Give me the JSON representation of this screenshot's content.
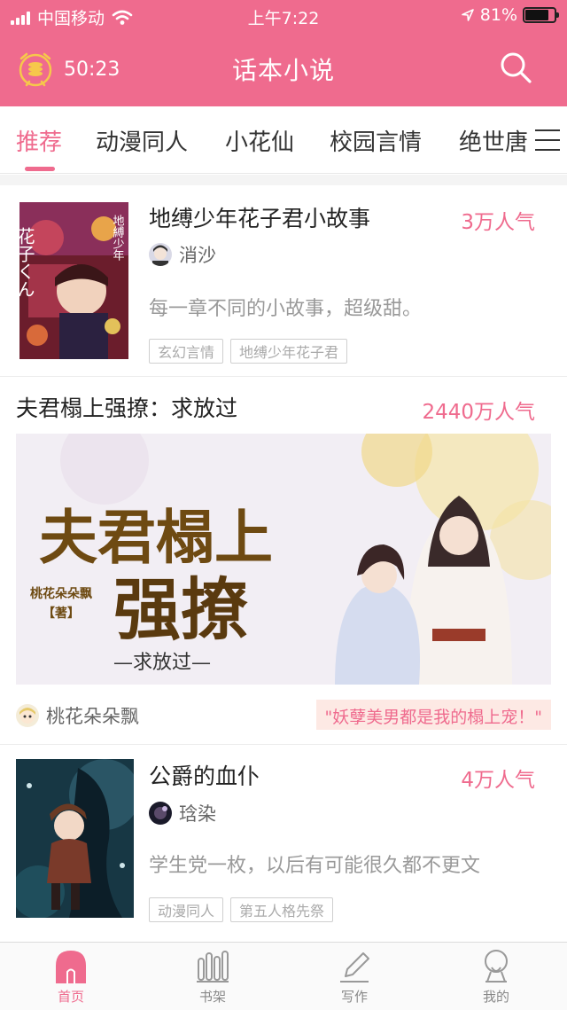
{
  "status_bar": {
    "carrier": "中国移动",
    "time": "上午7:22",
    "battery": "81%",
    "battery_level": 0.81
  },
  "header": {
    "timer": "50:23",
    "title": "话本小说"
  },
  "tabs": [
    "推荐",
    "动漫同人",
    "小花仙",
    "校园言情",
    "绝世唐"
  ],
  "cards": [
    {
      "title": "地缚少年花子君小故事",
      "popularity": "3万人气",
      "author": "消沙",
      "description": "每一章不同的小故事，超级甜。",
      "tags": [
        "玄幻言情",
        "地缚少年花子君"
      ]
    },
    {
      "title": "夫君榻上强撩：求放过",
      "popularity": "2440万人气",
      "author": "桃花朵朵飘",
      "quote": "\"妖孽美男都是我的榻上宠！\"",
      "banner_text": {
        "line1": "夫君榻上",
        "line2": "强撩",
        "subtitle": "—求放过—",
        "author_tag": "桃花朵朵飘",
        "author_suffix": "【著】"
      }
    },
    {
      "title": "公爵的血仆",
      "popularity": "4万人气",
      "author": "琀染",
      "description": "学生党一枚，以后有可能很久都不更文",
      "tags": [
        "动漫同人",
        "第五人格先祭"
      ]
    }
  ],
  "cover_text": {
    "left": "花子くん",
    "right": "地縛少年"
  },
  "bottom_nav": [
    {
      "label": "首页",
      "icon": "home-icon",
      "active": true
    },
    {
      "label": "书架",
      "icon": "bookshelf-icon",
      "active": false
    },
    {
      "label": "写作",
      "icon": "pen-icon",
      "active": false
    },
    {
      "label": "我的",
      "icon": "profile-icon",
      "active": false
    }
  ],
  "colors": {
    "accent": "#ef6b8e",
    "quote_bg": "#fde9e4"
  }
}
